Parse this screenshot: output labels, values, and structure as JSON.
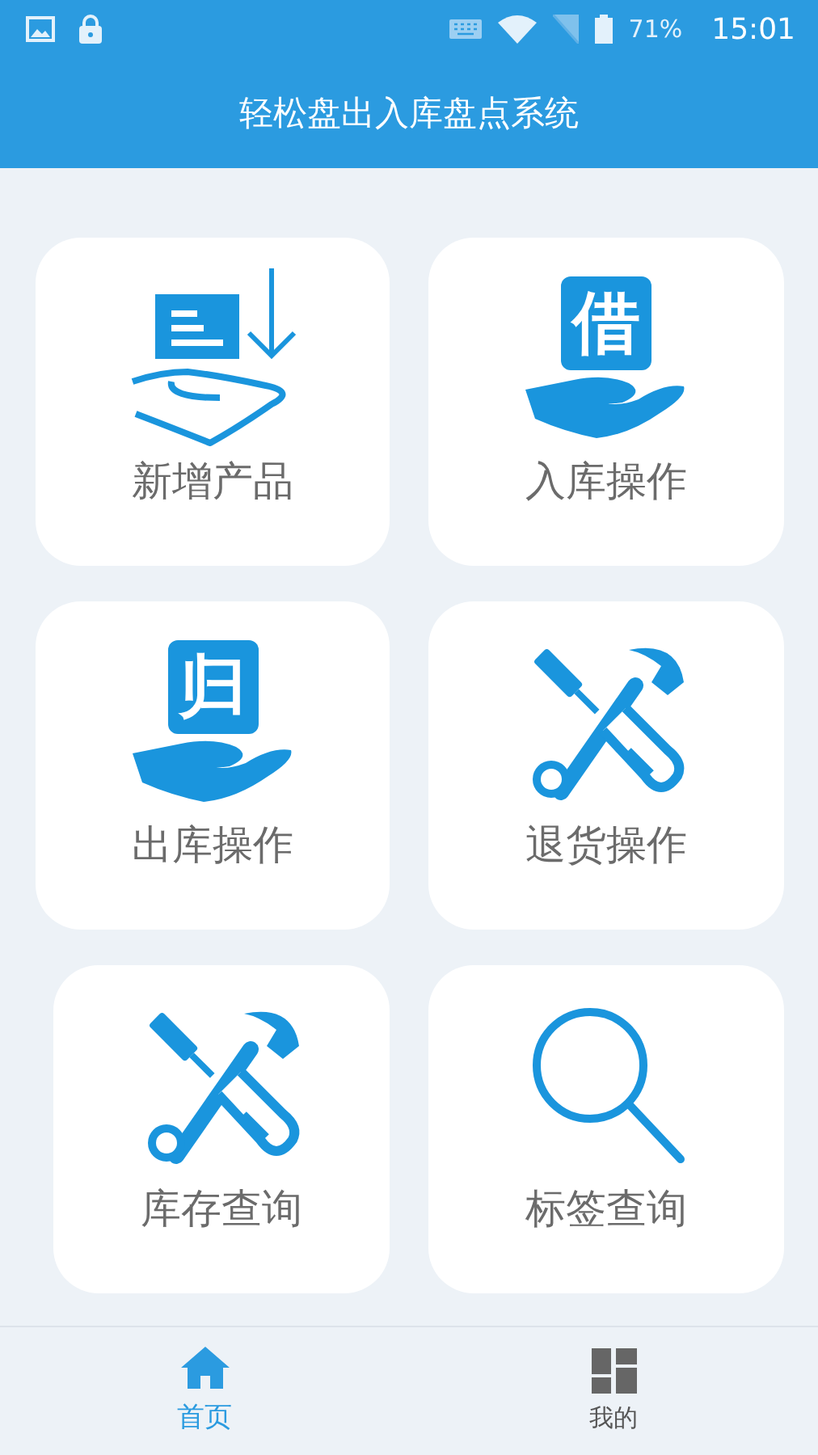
{
  "status_bar": {
    "battery": "71%",
    "time": "15:01"
  },
  "header": {
    "title": "轻松盘出入库盘点系统"
  },
  "tiles": [
    {
      "kind": "doc-hand",
      "label": "新增产品"
    },
    {
      "kind": "glyph-hand",
      "label": "入库操作"
    },
    {
      "kind": "glyph-hand",
      "label": "出库操作"
    },
    {
      "kind": "tools",
      "label": "退货操作"
    },
    {
      "kind": "tools",
      "label": "库存查询"
    },
    {
      "kind": "search",
      "label": "标签查询"
    }
  ],
  "tile_glyphs": [
    "借",
    "归"
  ],
  "nav": [
    {
      "kind": "home",
      "label": "首页",
      "selected": true
    },
    {
      "kind": "grid",
      "label": "我的",
      "selected": false
    }
  ]
}
